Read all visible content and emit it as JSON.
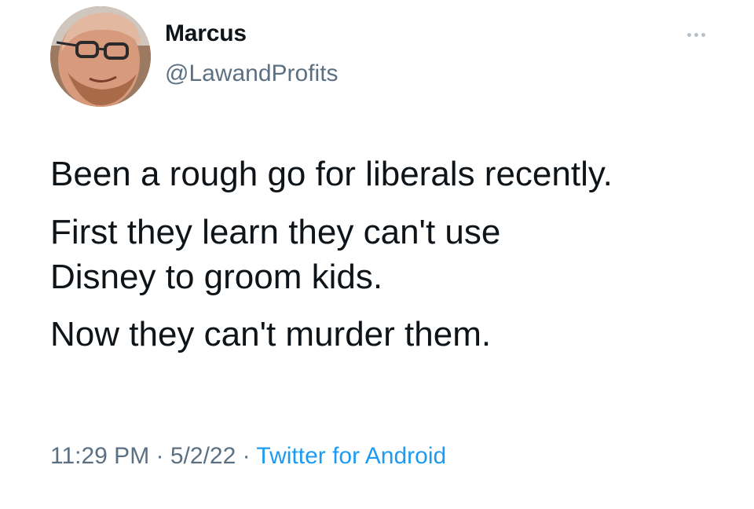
{
  "author": {
    "display_name": "Marcus",
    "handle": "@LawandProfits",
    "avatar_icon": "user-avatar-photo"
  },
  "menu": {
    "icon": "more-options-icon"
  },
  "tweet": {
    "paragraphs": [
      "Been a rough go for liberals recently.",
      "First they learn they can't use",
      "Disney to groom kids.",
      "Now they can't murder them."
    ]
  },
  "meta": {
    "time": "11:29 PM",
    "separator": " · ",
    "date": "5/2/22",
    "source": "Twitter for Android"
  },
  "colors": {
    "text": "#0f1419",
    "secondary": "#5b7083",
    "link": "#1d9bf0"
  }
}
